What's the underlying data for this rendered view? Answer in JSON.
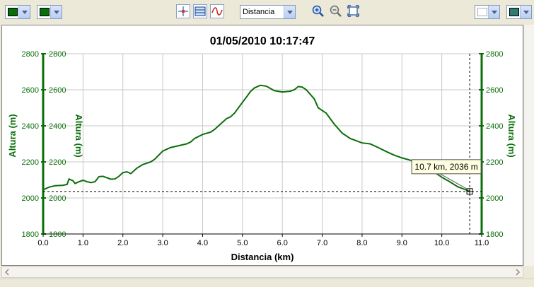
{
  "toolbar": {
    "line_color_combo": {
      "swatch_color": "#0a6e0a"
    },
    "fill_color_combo": {
      "swatch_color": "#0a6e0a"
    },
    "view_buttons": [
      "crosshair-icon",
      "grid-lines-icon",
      "smooth-curve-icon"
    ],
    "axis_select": {
      "value": "Distancia"
    },
    "zoom_buttons": [
      "zoom-in-icon",
      "zoom-out-icon",
      "zoom-fit-icon"
    ],
    "right_combo_1": {
      "swatch_color": "#ffffff"
    },
    "right_combo_2": {
      "swatch_color": "#2e7d6e"
    }
  },
  "chart_data": {
    "type": "line",
    "title": "01/05/2010 10:17:47",
    "xlabel": "Distancia (km)",
    "ylabel_left": "Altura (m)",
    "ylabel_right": "Altura (m)",
    "xlim": [
      0,
      11
    ],
    "ylim": [
      1800,
      2800
    ],
    "x_ticks": [
      "0.0",
      "1.0",
      "2.0",
      "3.0",
      "4.0",
      "5.0",
      "6.0",
      "7.0",
      "8.0",
      "9.0",
      "10.0",
      "11.0"
    ],
    "y_ticks": [
      "1800",
      "2000",
      "2200",
      "2400",
      "2600",
      "2800"
    ],
    "grid": true,
    "line_color": "#0a6e0a",
    "series": [
      {
        "x": [
          0,
          0.15,
          0.3,
          0.5,
          0.6,
          0.65,
          0.75,
          0.8,
          0.9,
          1.0,
          1.1,
          1.2,
          1.3,
          1.4,
          1.5,
          1.7,
          1.8,
          1.9,
          2.0,
          2.1,
          2.2,
          2.35,
          2.5,
          2.7,
          2.8,
          3.0,
          3.2,
          3.4,
          3.6,
          3.7,
          3.8,
          4.0,
          4.2,
          4.3,
          4.5,
          4.6,
          4.7,
          4.8,
          5.0,
          5.1,
          5.2,
          5.3,
          5.45,
          5.6,
          5.8,
          6.0,
          6.2,
          6.3,
          6.4,
          6.5,
          6.6,
          6.8,
          6.9,
          7.1,
          7.3,
          7.5,
          7.7,
          8.0,
          8.2,
          8.4,
          8.6,
          8.8,
          9.0,
          9.2,
          9.4,
          9.6,
          9.8,
          10.0,
          10.2,
          10.4,
          10.6,
          10.7
        ],
        "y": [
          2045,
          2060,
          2068,
          2070,
          2075,
          2105,
          2095,
          2080,
          2090,
          2098,
          2090,
          2085,
          2090,
          2118,
          2120,
          2104,
          2105,
          2120,
          2140,
          2145,
          2135,
          2165,
          2185,
          2200,
          2215,
          2260,
          2280,
          2290,
          2300,
          2310,
          2330,
          2352,
          2365,
          2380,
          2420,
          2440,
          2450,
          2470,
          2530,
          2560,
          2590,
          2610,
          2625,
          2620,
          2595,
          2588,
          2592,
          2600,
          2618,
          2615,
          2600,
          2550,
          2500,
          2470,
          2410,
          2360,
          2330,
          2305,
          2300,
          2280,
          2258,
          2238,
          2222,
          2210,
          2195,
          2170,
          2145,
          2115,
          2090,
          2062,
          2045,
          2036
        ]
      }
    ],
    "cursor": {
      "x": 10.7,
      "y": 2036,
      "label": "10.7 km, 2036 m"
    }
  }
}
